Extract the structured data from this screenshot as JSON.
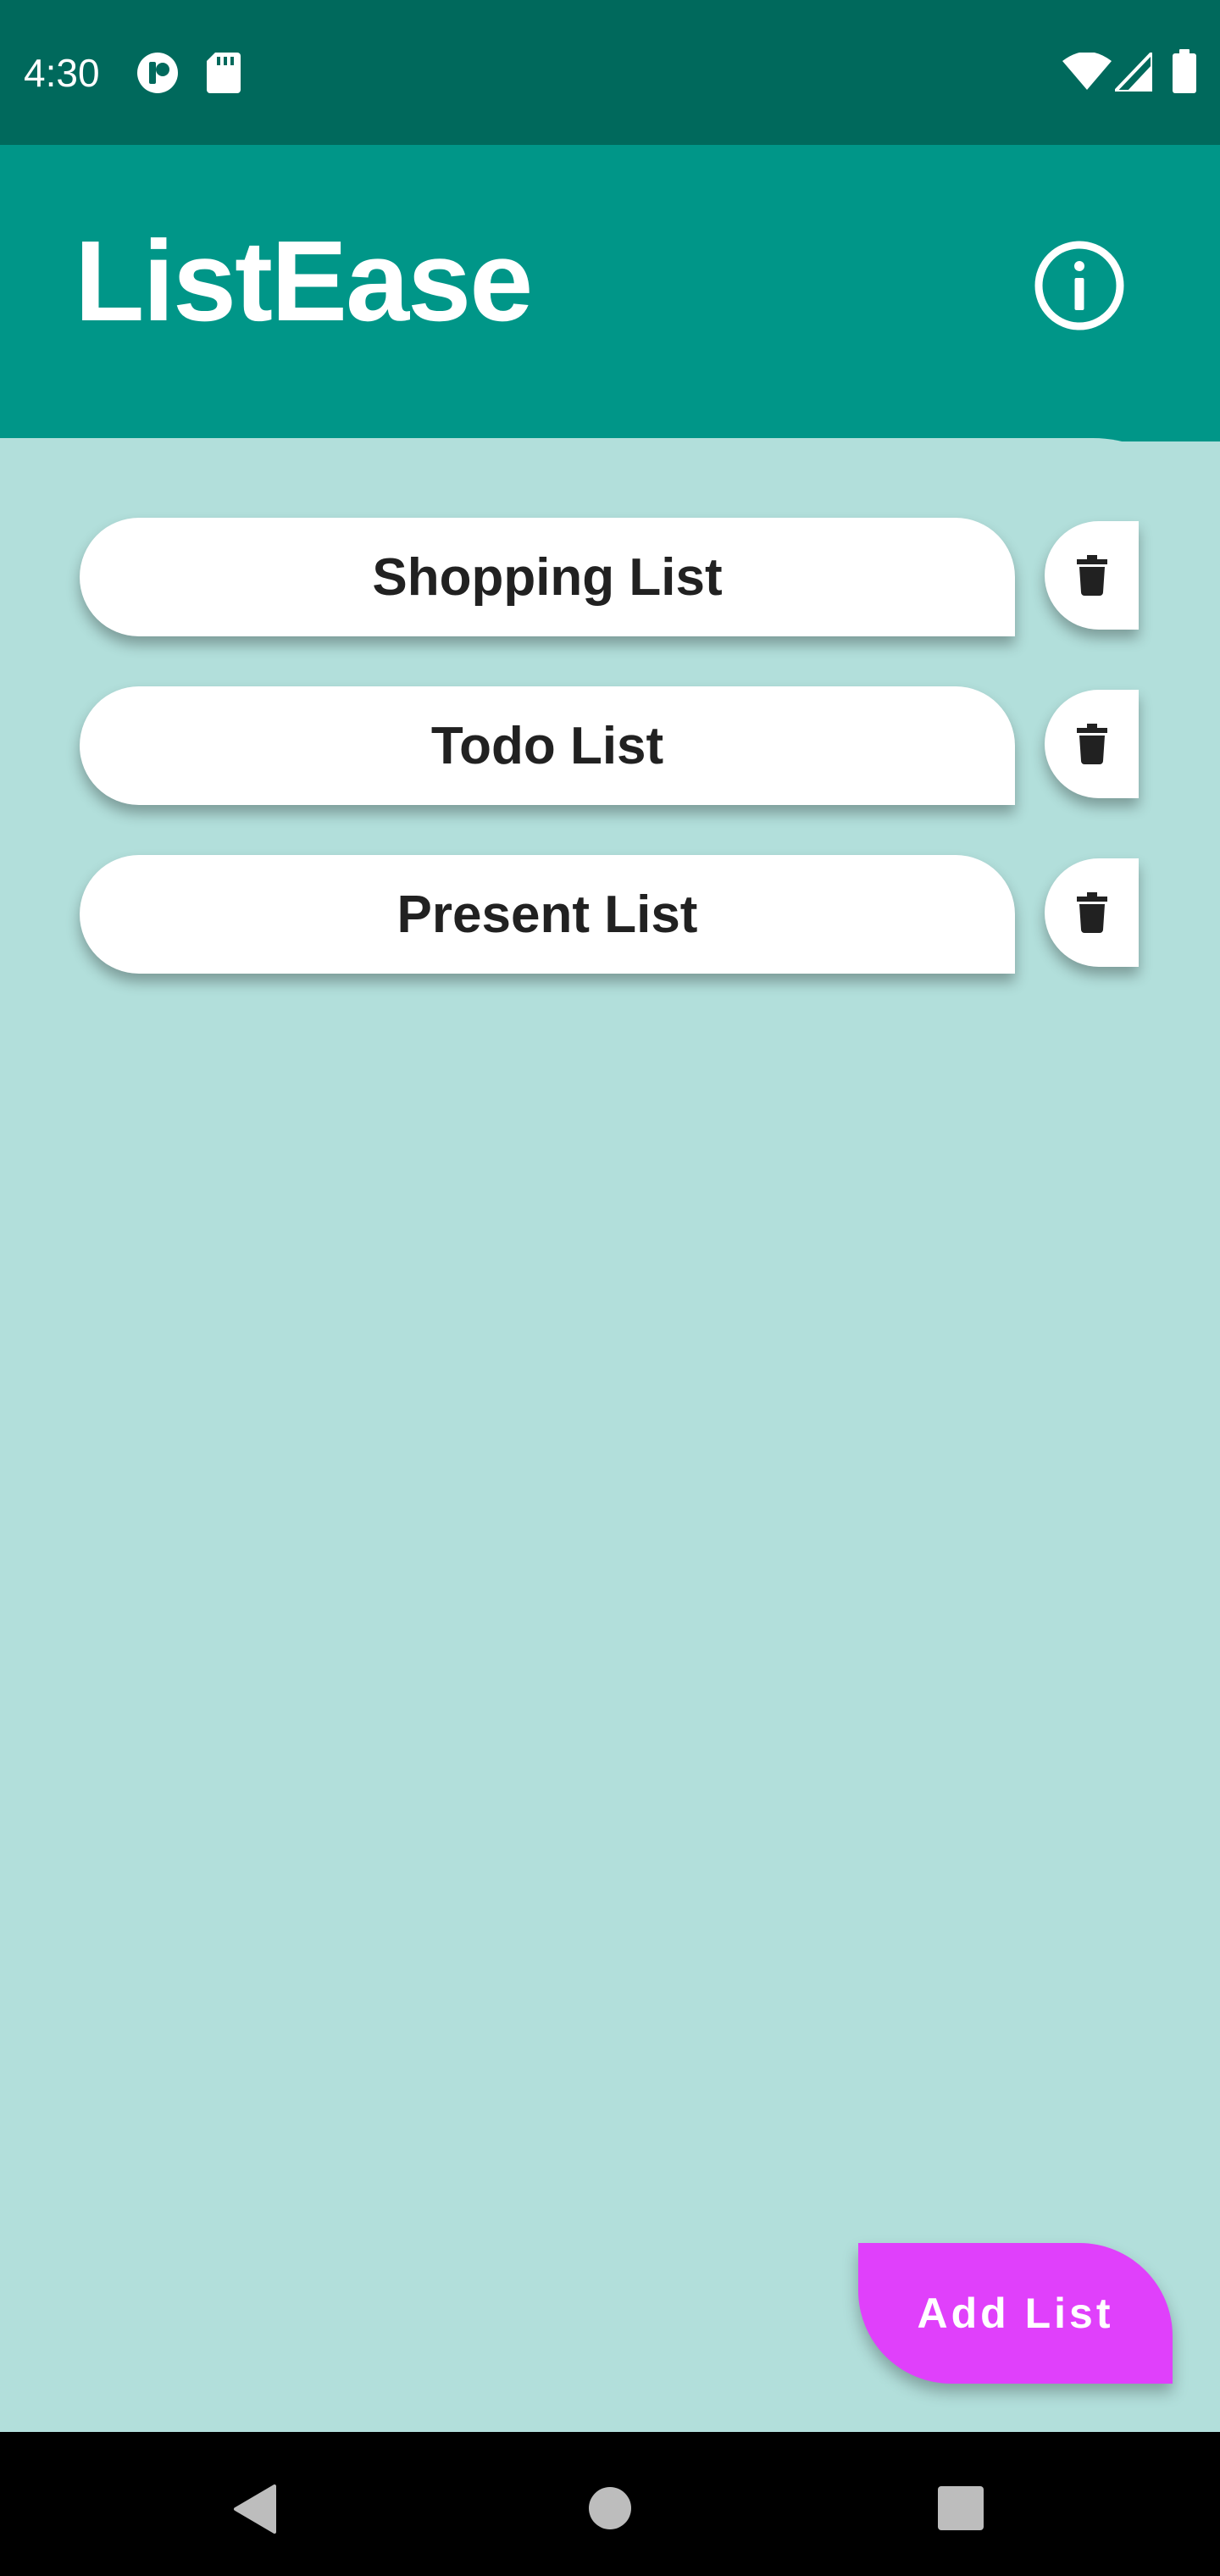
{
  "status_bar": {
    "time": "4:30",
    "left_icons": [
      "app-notification-icon",
      "sd-card-icon"
    ],
    "right_icons": [
      "wifi-icon",
      "cell-signal-icon",
      "battery-icon"
    ]
  },
  "app_bar": {
    "title": "ListEase",
    "info_icon": "info-icon"
  },
  "lists": [
    {
      "label": "Shopping List",
      "delete_icon": "trash-icon"
    },
    {
      "label": "Todo List",
      "delete_icon": "trash-icon"
    },
    {
      "label": "Present List",
      "delete_icon": "trash-icon"
    }
  ],
  "fab": {
    "label": "Add List"
  },
  "navigation": {
    "buttons": [
      "back-icon",
      "home-icon",
      "recents-icon"
    ]
  },
  "colors": {
    "status_bar": "#00695c",
    "app_bar": "#009688",
    "background": "#b2dfdb",
    "card": "#ffffff",
    "fab": "#e040fb",
    "text": "#212121",
    "nav_bar": "#000000"
  }
}
